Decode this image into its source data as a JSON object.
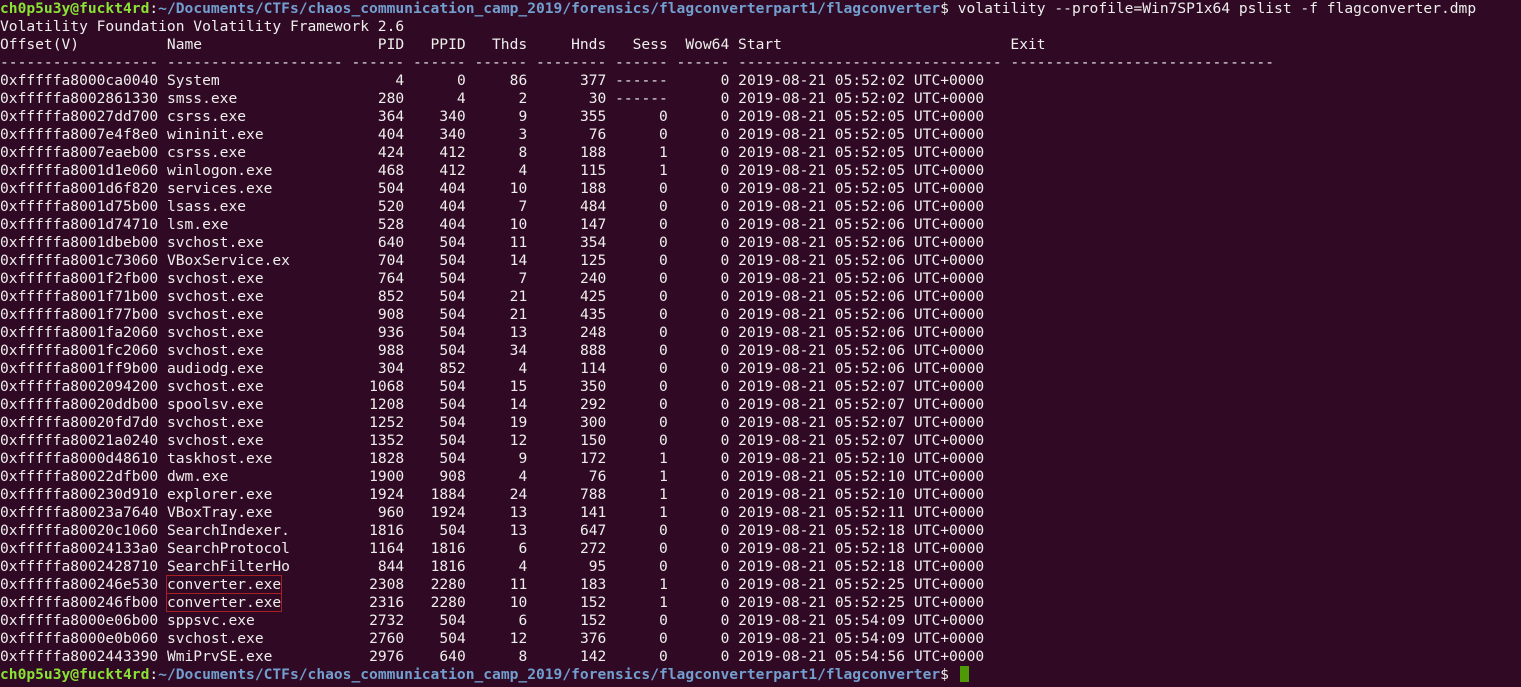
{
  "prompt": {
    "user_host": "ch0p5u3y@fuckt4rd",
    "sep": ":",
    "path": "~/Documents/CTFs/chaos_communication_camp_2019/forensics/flagconverterpart1/flagconverter",
    "dollar": "$ "
  },
  "command": "volatility --profile=Win7SP1x64 pslist -f flagconverter.dmp",
  "banner": "Volatility Foundation Volatility Framework 2.6",
  "table_header": "Offset(V)          Name                    PID   PPID   Thds     Hnds   Sess  Wow64 Start                          Exit",
  "table_divider": "------------------ -------------------- ------ ------ ------ -------- ------ ------ ------------------------------ ------------------------------",
  "rows": [
    {
      "offset": "0xfffffa8000ca0040",
      "name": "System",
      "pid": "4",
      "ppid": "0",
      "thds": "86",
      "hnds": "377",
      "sess": "------",
      "wow64": "0",
      "start": "2019-08-21 05:52:02 UTC+0000",
      "highlight": false
    },
    {
      "offset": "0xfffffa8002861330",
      "name": "smss.exe",
      "pid": "280",
      "ppid": "4",
      "thds": "2",
      "hnds": "30",
      "sess": "------",
      "wow64": "0",
      "start": "2019-08-21 05:52:02 UTC+0000",
      "highlight": false
    },
    {
      "offset": "0xfffffa80027dd700",
      "name": "csrss.exe",
      "pid": "364",
      "ppid": "340",
      "thds": "9",
      "hnds": "355",
      "sess": "0",
      "wow64": "0",
      "start": "2019-08-21 05:52:05 UTC+0000",
      "highlight": false
    },
    {
      "offset": "0xfffffa8007e4f8e0",
      "name": "wininit.exe",
      "pid": "404",
      "ppid": "340",
      "thds": "3",
      "hnds": "76",
      "sess": "0",
      "wow64": "0",
      "start": "2019-08-21 05:52:05 UTC+0000",
      "highlight": false
    },
    {
      "offset": "0xfffffa8007eaeb00",
      "name": "csrss.exe",
      "pid": "424",
      "ppid": "412",
      "thds": "8",
      "hnds": "188",
      "sess": "1",
      "wow64": "0",
      "start": "2019-08-21 05:52:05 UTC+0000",
      "highlight": false
    },
    {
      "offset": "0xfffffa8001d1e060",
      "name": "winlogon.exe",
      "pid": "468",
      "ppid": "412",
      "thds": "4",
      "hnds": "115",
      "sess": "1",
      "wow64": "0",
      "start": "2019-08-21 05:52:05 UTC+0000",
      "highlight": false
    },
    {
      "offset": "0xfffffa8001d6f820",
      "name": "services.exe",
      "pid": "504",
      "ppid": "404",
      "thds": "10",
      "hnds": "188",
      "sess": "0",
      "wow64": "0",
      "start": "2019-08-21 05:52:05 UTC+0000",
      "highlight": false
    },
    {
      "offset": "0xfffffa8001d75b00",
      "name": "lsass.exe",
      "pid": "520",
      "ppid": "404",
      "thds": "7",
      "hnds": "484",
      "sess": "0",
      "wow64": "0",
      "start": "2019-08-21 05:52:06 UTC+0000",
      "highlight": false
    },
    {
      "offset": "0xfffffa8001d74710",
      "name": "lsm.exe",
      "pid": "528",
      "ppid": "404",
      "thds": "10",
      "hnds": "147",
      "sess": "0",
      "wow64": "0",
      "start": "2019-08-21 05:52:06 UTC+0000",
      "highlight": false
    },
    {
      "offset": "0xfffffa8001dbeb00",
      "name": "svchost.exe",
      "pid": "640",
      "ppid": "504",
      "thds": "11",
      "hnds": "354",
      "sess": "0",
      "wow64": "0",
      "start": "2019-08-21 05:52:06 UTC+0000",
      "highlight": false
    },
    {
      "offset": "0xfffffa8001c73060",
      "name": "VBoxService.ex",
      "pid": "704",
      "ppid": "504",
      "thds": "14",
      "hnds": "125",
      "sess": "0",
      "wow64": "0",
      "start": "2019-08-21 05:52:06 UTC+0000",
      "highlight": false
    },
    {
      "offset": "0xfffffa8001f2fb00",
      "name": "svchost.exe",
      "pid": "764",
      "ppid": "504",
      "thds": "7",
      "hnds": "240",
      "sess": "0",
      "wow64": "0",
      "start": "2019-08-21 05:52:06 UTC+0000",
      "highlight": false
    },
    {
      "offset": "0xfffffa8001f71b00",
      "name": "svchost.exe",
      "pid": "852",
      "ppid": "504",
      "thds": "21",
      "hnds": "425",
      "sess": "0",
      "wow64": "0",
      "start": "2019-08-21 05:52:06 UTC+0000",
      "highlight": false
    },
    {
      "offset": "0xfffffa8001f77b00",
      "name": "svchost.exe",
      "pid": "908",
      "ppid": "504",
      "thds": "21",
      "hnds": "435",
      "sess": "0",
      "wow64": "0",
      "start": "2019-08-21 05:52:06 UTC+0000",
      "highlight": false
    },
    {
      "offset": "0xfffffa8001fa2060",
      "name": "svchost.exe",
      "pid": "936",
      "ppid": "504",
      "thds": "13",
      "hnds": "248",
      "sess": "0",
      "wow64": "0",
      "start": "2019-08-21 05:52:06 UTC+0000",
      "highlight": false
    },
    {
      "offset": "0xfffffa8001fc2060",
      "name": "svchost.exe",
      "pid": "988",
      "ppid": "504",
      "thds": "34",
      "hnds": "888",
      "sess": "0",
      "wow64": "0",
      "start": "2019-08-21 05:52:06 UTC+0000",
      "highlight": false
    },
    {
      "offset": "0xfffffa8001ff9b00",
      "name": "audiodg.exe",
      "pid": "304",
      "ppid": "852",
      "thds": "4",
      "hnds": "114",
      "sess": "0",
      "wow64": "0",
      "start": "2019-08-21 05:52:06 UTC+0000",
      "highlight": false
    },
    {
      "offset": "0xfffffa8002094200",
      "name": "svchost.exe",
      "pid": "1068",
      "ppid": "504",
      "thds": "15",
      "hnds": "350",
      "sess": "0",
      "wow64": "0",
      "start": "2019-08-21 05:52:07 UTC+0000",
      "highlight": false
    },
    {
      "offset": "0xfffffa80020ddb00",
      "name": "spoolsv.exe",
      "pid": "1208",
      "ppid": "504",
      "thds": "14",
      "hnds": "292",
      "sess": "0",
      "wow64": "0",
      "start": "2019-08-21 05:52:07 UTC+0000",
      "highlight": false
    },
    {
      "offset": "0xfffffa80020fd7d0",
      "name": "svchost.exe",
      "pid": "1252",
      "ppid": "504",
      "thds": "19",
      "hnds": "300",
      "sess": "0",
      "wow64": "0",
      "start": "2019-08-21 05:52:07 UTC+0000",
      "highlight": false
    },
    {
      "offset": "0xfffffa80021a0240",
      "name": "svchost.exe",
      "pid": "1352",
      "ppid": "504",
      "thds": "12",
      "hnds": "150",
      "sess": "0",
      "wow64": "0",
      "start": "2019-08-21 05:52:07 UTC+0000",
      "highlight": false
    },
    {
      "offset": "0xfffffa8000d48610",
      "name": "taskhost.exe",
      "pid": "1828",
      "ppid": "504",
      "thds": "9",
      "hnds": "172",
      "sess": "1",
      "wow64": "0",
      "start": "2019-08-21 05:52:10 UTC+0000",
      "highlight": false
    },
    {
      "offset": "0xfffffa80022dfb00",
      "name": "dwm.exe",
      "pid": "1900",
      "ppid": "908",
      "thds": "4",
      "hnds": "76",
      "sess": "1",
      "wow64": "0",
      "start": "2019-08-21 05:52:10 UTC+0000",
      "highlight": false
    },
    {
      "offset": "0xfffffa800230d910",
      "name": "explorer.exe",
      "pid": "1924",
      "ppid": "1884",
      "thds": "24",
      "hnds": "788",
      "sess": "1",
      "wow64": "0",
      "start": "2019-08-21 05:52:10 UTC+0000",
      "highlight": false
    },
    {
      "offset": "0xfffffa80023a7640",
      "name": "VBoxTray.exe",
      "pid": "960",
      "ppid": "1924",
      "thds": "13",
      "hnds": "141",
      "sess": "1",
      "wow64": "0",
      "start": "2019-08-21 05:52:11 UTC+0000",
      "highlight": false
    },
    {
      "offset": "0xfffffa80020c1060",
      "name": "SearchIndexer.",
      "pid": "1816",
      "ppid": "504",
      "thds": "13",
      "hnds": "647",
      "sess": "0",
      "wow64": "0",
      "start": "2019-08-21 05:52:18 UTC+0000",
      "highlight": false
    },
    {
      "offset": "0xfffffa80024133a0",
      "name": "SearchProtocol",
      "pid": "1164",
      "ppid": "1816",
      "thds": "6",
      "hnds": "272",
      "sess": "0",
      "wow64": "0",
      "start": "2019-08-21 05:52:18 UTC+0000",
      "highlight": false
    },
    {
      "offset": "0xfffffa8002428710",
      "name": "SearchFilterHo",
      "pid": "844",
      "ppid": "1816",
      "thds": "4",
      "hnds": "95",
      "sess": "0",
      "wow64": "0",
      "start": "2019-08-21 05:52:18 UTC+0000",
      "highlight": false
    },
    {
      "offset": "0xfffffa800246e530",
      "name": "converter.exe",
      "pid": "2308",
      "ppid": "2280",
      "thds": "11",
      "hnds": "183",
      "sess": "1",
      "wow64": "0",
      "start": "2019-08-21 05:52:25 UTC+0000",
      "highlight": true
    },
    {
      "offset": "0xfffffa800246fb00",
      "name": "converter.exe",
      "pid": "2316",
      "ppid": "2280",
      "thds": "10",
      "hnds": "152",
      "sess": "1",
      "wow64": "0",
      "start": "2019-08-21 05:52:25 UTC+0000",
      "highlight": true
    },
    {
      "offset": "0xfffffa8000e06b00",
      "name": "sppsvc.exe",
      "pid": "2732",
      "ppid": "504",
      "thds": "6",
      "hnds": "152",
      "sess": "0",
      "wow64": "0",
      "start": "2019-08-21 05:54:09 UTC+0000",
      "highlight": false
    },
    {
      "offset": "0xfffffa8000e0b060",
      "name": "svchost.exe",
      "pid": "2760",
      "ppid": "504",
      "thds": "12",
      "hnds": "376",
      "sess": "0",
      "wow64": "0",
      "start": "2019-08-21 05:54:09 UTC+0000",
      "highlight": false
    },
    {
      "offset": "0xfffffa8002443390",
      "name": "WmiPrvSE.exe",
      "pid": "2976",
      "ppid": "640",
      "thds": "8",
      "hnds": "142",
      "sess": "0",
      "wow64": "0",
      "start": "2019-08-21 05:54:56 UTC+0000",
      "highlight": false
    }
  ],
  "colors": {
    "background": "#300a24",
    "text": "#eeeeec",
    "user_host": "#8ae234",
    "path": "#729fcf",
    "cursor": "#4e9a06",
    "highlight_box": "#a62121"
  }
}
